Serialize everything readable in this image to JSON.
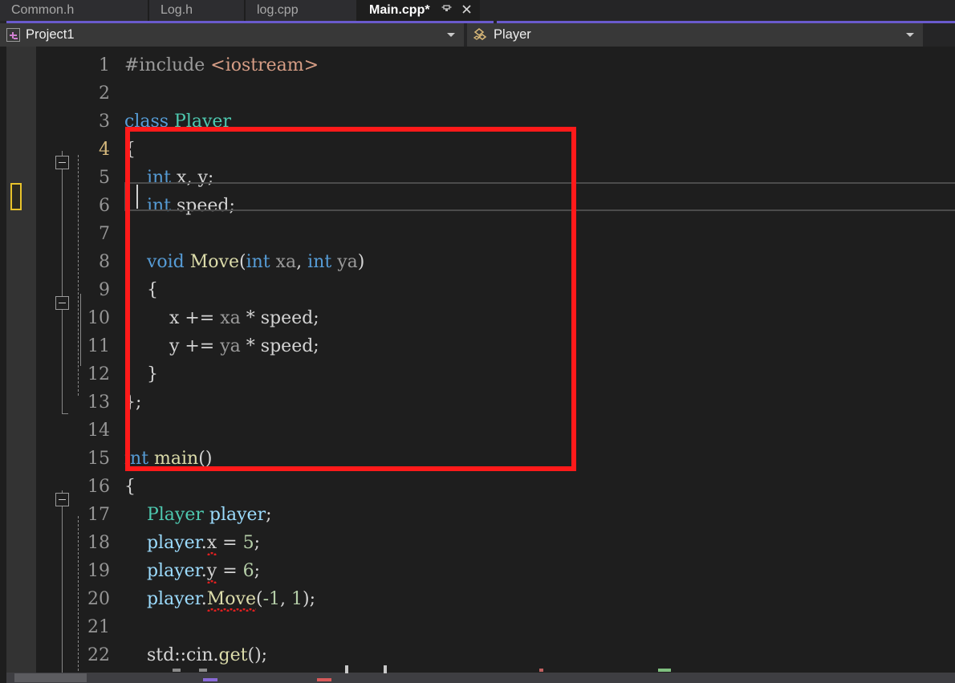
{
  "window": {
    "app": "Visual Studio",
    "accent_color": "#6a5acd",
    "background": "#1e1e1e"
  },
  "tabs": {
    "items": [
      {
        "label": "Common.h",
        "active": false,
        "modified": false
      },
      {
        "label": "Log.h",
        "active": false,
        "modified": false
      },
      {
        "label": "log.cpp",
        "active": false,
        "modified": false
      },
      {
        "label": "Main.cpp*",
        "active": true,
        "modified": true
      }
    ],
    "pin_icon": "pin-icon",
    "pin_glyph": "⚏",
    "close_icon": "close-icon",
    "close_glyph": "✕"
  },
  "navbar": {
    "project": {
      "icon": "project-icon",
      "label": "Project1",
      "caret": "chevron-down-icon"
    },
    "member": {
      "icon": "class-member-icon",
      "label": "Player",
      "caret": "chevron-down-icon"
    }
  },
  "editor": {
    "language": "cpp",
    "current_line": 4,
    "caret": {
      "line": 4,
      "column": 2
    },
    "line_numbers": [
      "1",
      "2",
      "3",
      "4",
      "5",
      "6",
      "7",
      "8",
      "9",
      "10",
      "11",
      "12",
      "13",
      "14",
      "15",
      "16",
      "17",
      "18",
      "19",
      "20",
      "21",
      "22"
    ],
    "lines": [
      {
        "n": "1",
        "text": "#include <iostream>"
      },
      {
        "n": "2",
        "text": ""
      },
      {
        "n": "3",
        "text": "class Player"
      },
      {
        "n": "4",
        "text": "{"
      },
      {
        "n": "5",
        "text": "    int x, y;"
      },
      {
        "n": "6",
        "text": "    int speed;"
      },
      {
        "n": "7",
        "text": ""
      },
      {
        "n": "8",
        "text": "    void Move(int xa, int ya)"
      },
      {
        "n": "9",
        "text": "    {"
      },
      {
        "n": "10",
        "text": "        x += xa * speed;"
      },
      {
        "n": "11",
        "text": "        y += ya * speed;"
      },
      {
        "n": "12",
        "text": "    }"
      },
      {
        "n": "13",
        "text": "};"
      },
      {
        "n": "14",
        "text": ""
      },
      {
        "n": "15",
        "text": "int main()"
      },
      {
        "n": "16",
        "text": "{"
      },
      {
        "n": "17",
        "text": "    Player player;"
      },
      {
        "n": "18",
        "text": "    player.x = 5;"
      },
      {
        "n": "19",
        "text": "    player.y = 6;"
      },
      {
        "n": "20",
        "text": "    player.Move(-1, 1);"
      },
      {
        "n": "21",
        "text": ""
      },
      {
        "n": "22",
        "text": "    std::cin.get();"
      }
    ],
    "errors": [
      {
        "line": "18",
        "token": "x",
        "kind": "squiggle-red"
      },
      {
        "line": "19",
        "token": "y",
        "kind": "squiggle-red"
      },
      {
        "line": "20",
        "token": "Move",
        "kind": "squiggle-red"
      }
    ],
    "fold_markers": [
      {
        "line": "3",
        "state": "expanded"
      },
      {
        "line": "8",
        "state": "expanded"
      },
      {
        "line": "15",
        "state": "expanded"
      }
    ],
    "colors": {
      "keyword": "#569cd6",
      "type": "#4ec9b0",
      "function": "#dcdcaa",
      "variable": "#9cdcfe",
      "number": "#b5cea8",
      "string": "#d69d85",
      "preprocessor": "#9b9b9b",
      "plain": "#d4d4d4",
      "current_line_number": "#d7ba7d",
      "line_number": "#969696"
    }
  },
  "annotation": {
    "name": "red-highlight-rectangle",
    "color": "#ff1a1a",
    "covers_lines": "2-13"
  },
  "scrollbar": {
    "orientation": "horizontal",
    "track_color": "#3e3e42",
    "thumb_color": "#5c5c60"
  }
}
